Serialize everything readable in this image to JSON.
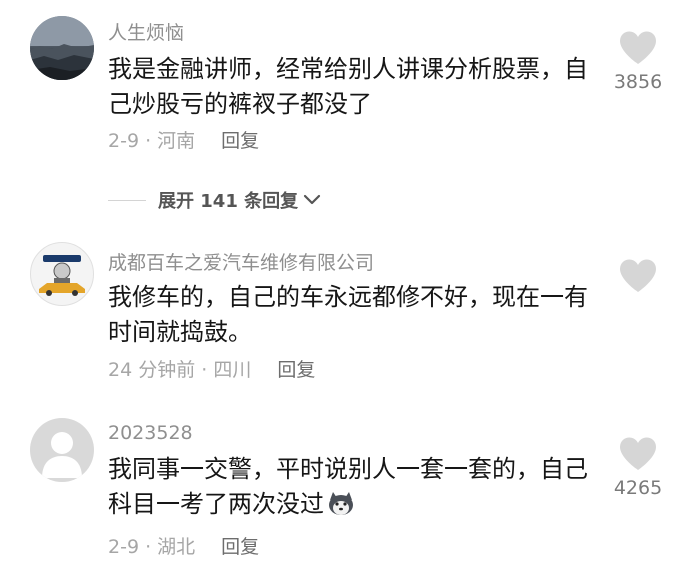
{
  "comments": [
    {
      "username": "人生烦恼",
      "text": "我是金融讲师，经常给别人讲课分析股票，自己炒股亏的裤衩子都没了",
      "meta": "2-9 · 河南",
      "reply_label": "回复",
      "likes": "3856"
    },
    {
      "username": "成都百车之爱汽车维修有限公司",
      "text": "我修车的，自己的车永远都修不好，现在一有时间就捣鼓。",
      "meta": "24 分钟前 · 四川",
      "reply_label": "回复",
      "likes": ""
    },
    {
      "username": "2023528",
      "text": "我同事一交警，平时说别人一套一套的，自己科目一考了两次没过",
      "meta": "2-9 · 湖北",
      "reply_label": "回复",
      "likes": "4265"
    }
  ],
  "expand_replies": "展开 141 条回复",
  "colors": {
    "username": "#8f8f8f",
    "text": "#161616",
    "meta": "#a6a6a6",
    "heart": "#d6d6d6"
  },
  "icons": [
    "heart-icon",
    "chevron-down-icon",
    "default-avatar-icon",
    "husky-emoji-icon"
  ]
}
